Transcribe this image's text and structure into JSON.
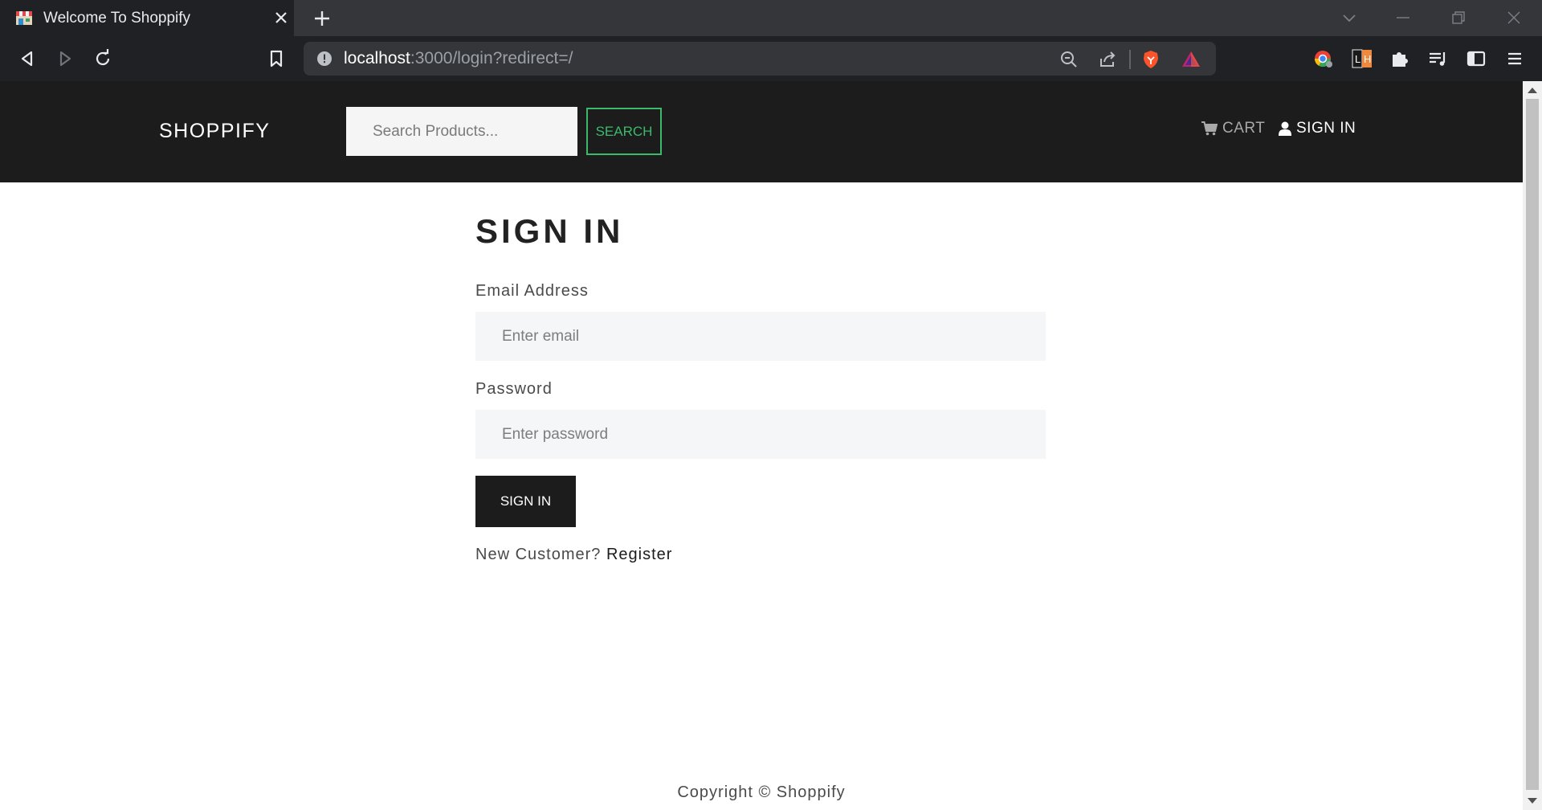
{
  "browser": {
    "tab": {
      "title": "Welcome To Shoppify"
    },
    "address": {
      "host": "localhost",
      "rest": ":3000/login?redirect=/"
    },
    "colors": {
      "chrome_bg": "#202124",
      "tabbar_bg": "#35363a",
      "brave_orange": "#fb542b"
    },
    "icons": [
      "back-icon",
      "forward-icon",
      "reload-icon",
      "bookmark-icon",
      "info-icon",
      "zoom-icon",
      "share-icon",
      "brave-shield-icon",
      "brave-rewards-icon",
      "extensions-icon",
      "playlist-icon",
      "sidebar-icon",
      "menu-icon"
    ]
  },
  "header": {
    "brand": "SHOPPIFY",
    "search": {
      "placeholder": "Search Products...",
      "button_label": "SEARCH"
    },
    "nav": {
      "cart_label": "CART",
      "signin_label": "SIGN IN"
    },
    "colors": {
      "background": "#1c1c1c",
      "accent": "#3cba6c"
    }
  },
  "form": {
    "title": "SIGN IN",
    "email": {
      "label": "Email Address",
      "placeholder": "Enter email"
    },
    "password": {
      "label": "Password",
      "placeholder": "Enter password"
    },
    "submit_label": "SIGN IN",
    "register_prompt": "New Customer?",
    "register_link": "Register"
  },
  "footer": {
    "text": "Copyright © Shoppify"
  }
}
